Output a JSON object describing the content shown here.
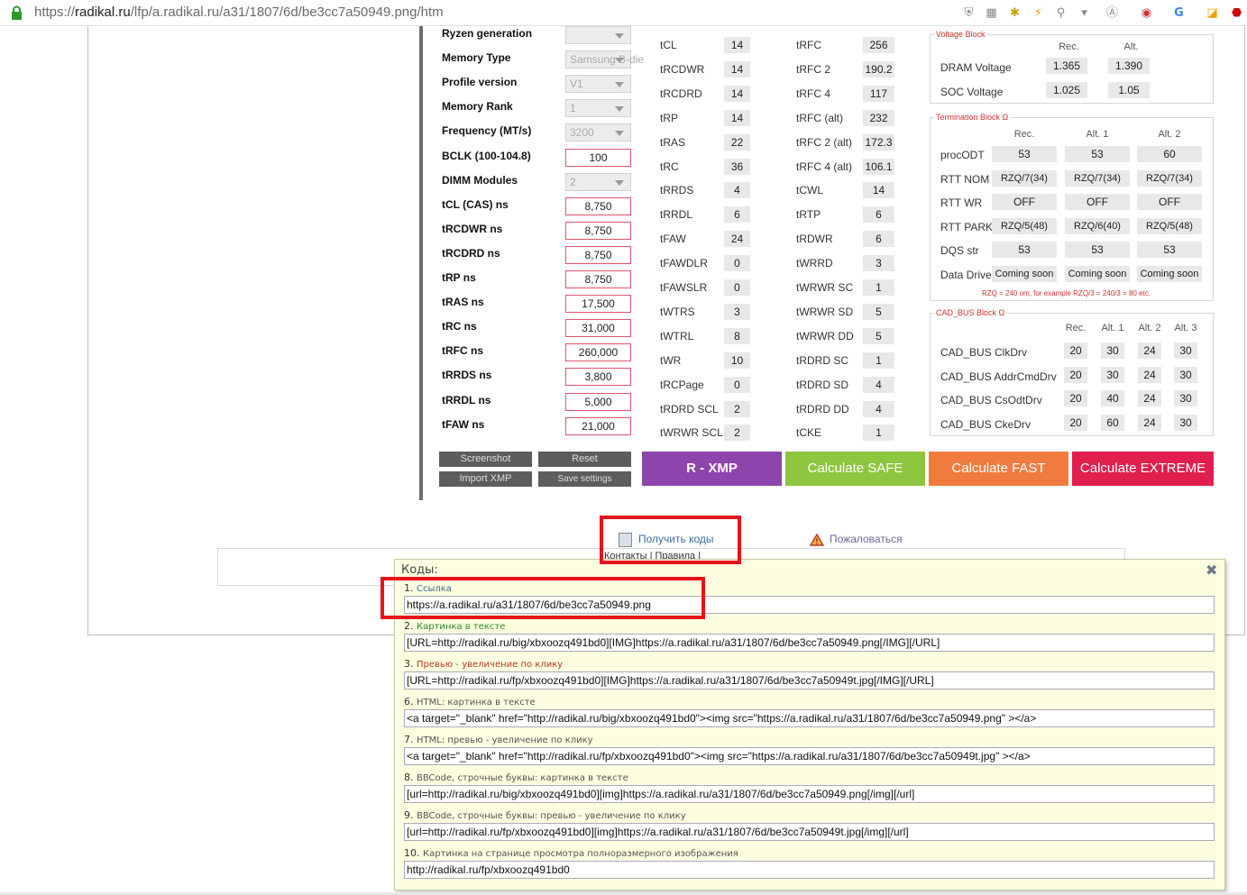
{
  "browser": {
    "url_prefix": "https://",
    "url_host": "radikal.ru",
    "url_path": "/lfp/a.radikal.ru/a31/1807/6d/be3cc7a50949.png/htm"
  },
  "left_panel": {
    "rows": [
      {
        "label": "Ryzen generation",
        "value": "",
        "kind": "select"
      },
      {
        "label": "Memory Type",
        "value": "Samsung B-die",
        "kind": "select"
      },
      {
        "label": "Profile version",
        "value": "V1",
        "kind": "select"
      },
      {
        "label": "Memory Rank",
        "value": "1",
        "kind": "select"
      },
      {
        "label": "Frequency (MT/s)",
        "value": "3200",
        "kind": "select"
      },
      {
        "label": "BCLK (100-104.8)",
        "value": "100",
        "kind": "input"
      },
      {
        "label": "DIMM Modules",
        "value": "2",
        "kind": "select"
      },
      {
        "label": "tCL (CAS) ns",
        "value": "8,750",
        "kind": "input"
      },
      {
        "label": "tRCDWR ns",
        "value": "8,750",
        "kind": "input"
      },
      {
        "label": "tRCDRD ns",
        "value": "8,750",
        "kind": "input"
      },
      {
        "label": "tRP ns",
        "value": "8,750",
        "kind": "input"
      },
      {
        "label": "tRAS ns",
        "value": "17,500",
        "kind": "input"
      },
      {
        "label": "tRC ns",
        "value": "31,000",
        "kind": "input"
      },
      {
        "label": "tRFC ns",
        "value": "260,000",
        "kind": "input"
      },
      {
        "label": "tRRDS ns",
        "value": "3,800",
        "kind": "input"
      },
      {
        "label": "tRRDL ns",
        "value": "5,000",
        "kind": "input"
      },
      {
        "label": "tFAW ns",
        "value": "21,000",
        "kind": "input"
      }
    ]
  },
  "timings_col1": [
    {
      "label": "tCL",
      "value": "14"
    },
    {
      "label": "tRCDWR",
      "value": "14"
    },
    {
      "label": "tRCDRD",
      "value": "14"
    },
    {
      "label": "tRP",
      "value": "14"
    },
    {
      "label": "tRAS",
      "value": "22"
    },
    {
      "label": "tRC",
      "value": "36"
    },
    {
      "label": "tRRDS",
      "value": "4"
    },
    {
      "label": "tRRDL",
      "value": "6"
    },
    {
      "label": "tFAW",
      "value": "24"
    },
    {
      "label": "tFAWDLR",
      "value": "0"
    },
    {
      "label": "tFAWSLR",
      "value": "0"
    },
    {
      "label": "tWTRS",
      "value": "3"
    },
    {
      "label": "tWTRL",
      "value": "8"
    },
    {
      "label": "tWR",
      "value": "10"
    },
    {
      "label": "tRCPage",
      "value": "0"
    },
    {
      "label": "tRDRD SCL",
      "value": "2"
    },
    {
      "label": "tWRWR SCL",
      "value": "2"
    }
  ],
  "timings_col2": [
    {
      "label": "tRFC",
      "value": "256"
    },
    {
      "label": "tRFC 2",
      "value": "190.2"
    },
    {
      "label": "tRFC 4",
      "value": "117"
    },
    {
      "label": "tRFC (alt)",
      "value": "232"
    },
    {
      "label": "tRFC 2 (alt)",
      "value": "172.3"
    },
    {
      "label": "tRFC 4 (alt)",
      "value": "106.1"
    },
    {
      "label": "tCWL",
      "value": "14"
    },
    {
      "label": "tRTP",
      "value": "6"
    },
    {
      "label": "tRDWR",
      "value": "6"
    },
    {
      "label": "tWRRD",
      "value": "3"
    },
    {
      "label": "tWRWR SC",
      "value": "1"
    },
    {
      "label": "tWRWR SD",
      "value": "5"
    },
    {
      "label": "tWRWR DD",
      "value": "5"
    },
    {
      "label": "tRDRD SC",
      "value": "1"
    },
    {
      "label": "tRDRD SD",
      "value": "4"
    },
    {
      "label": "tRDRD DD",
      "value": "4"
    },
    {
      "label": "tCKE",
      "value": "1"
    }
  ],
  "voltage_block": {
    "title": "Voltage Block",
    "headers": [
      "Rec.",
      "Alt."
    ],
    "rows": [
      {
        "label": "DRAM Voltage",
        "values": [
          "1.365",
          "1.390"
        ]
      },
      {
        "label": "SOC Voltage",
        "values": [
          "1.025",
          "1.05"
        ]
      }
    ]
  },
  "termination_block": {
    "title": "Termination Block Ω",
    "headers": [
      "Rec.",
      "Alt. 1",
      "Alt. 2"
    ],
    "rows": [
      {
        "label": "procODT",
        "values": [
          "53",
          "53",
          "60"
        ]
      },
      {
        "label": "RTT NOM",
        "values": [
          "RZQ/7(34)",
          "RZQ/7(34)",
          "RZQ/7(34)"
        ]
      },
      {
        "label": "RTT WR",
        "values": [
          "OFF",
          "OFF",
          "OFF"
        ]
      },
      {
        "label": "RTT PARK",
        "values": [
          "RZQ/5(48)",
          "RZQ/6(40)",
          "RZQ/5(48)"
        ]
      },
      {
        "label": "DQS str",
        "values": [
          "53",
          "53",
          "53"
        ]
      },
      {
        "label": "Data Drive",
        "values": [
          "Coming soon",
          "Coming soon",
          "Coming soon"
        ]
      }
    ],
    "note": "RZQ = 240 om, for example RZQ/3 = 240/3 = 80 etc."
  },
  "cad_bus_block": {
    "title": "CAD_BUS Block Ω",
    "headers": [
      "Rec.",
      "Alt. 1",
      "Alt. 2",
      "Alt. 3"
    ],
    "rows": [
      {
        "label": "CAD_BUS ClkDrv",
        "values": [
          "20",
          "30",
          "24",
          "30"
        ]
      },
      {
        "label": "CAD_BUS AddrCmdDrv",
        "values": [
          "20",
          "30",
          "24",
          "30"
        ]
      },
      {
        "label": "CAD_BUS CsOdtDrv",
        "values": [
          "20",
          "40",
          "24",
          "30"
        ]
      },
      {
        "label": "CAD_BUS CkeDrv",
        "values": [
          "20",
          "60",
          "24",
          "30"
        ]
      }
    ]
  },
  "buttons": {
    "screenshot": "Screenshot",
    "reset": "Reset",
    "import_xmp": "Import XMP",
    "save_settings": "Save settings",
    "r_xmp": "R - XMP",
    "calc_safe": "Calculate SAFE",
    "calc_fast": "Calculate FAST",
    "calc_extreme": "Calculate EXTREME"
  },
  "colors": {
    "r_xmp": "#8e44ad",
    "calc_safe": "#8dc63f",
    "calc_fast": "#f07b3f",
    "calc_extreme": "#e01f4e",
    "highlight_box": "#e8121a"
  },
  "actions": {
    "get_codes": "Получить коды",
    "complain": "Пожаловаться",
    "hidden_links": "Контакты | Правила |"
  },
  "popup": {
    "title": "Коды:",
    "close_icon": "close-icon",
    "items": [
      {
        "num": "1.",
        "label": "Ссылка",
        "label_color": "#3d6e9b",
        "value": "https://a.radikal.ru/a31/1807/6d/be3cc7a50949.png"
      },
      {
        "num": "2.",
        "label": "Картинка в тексте",
        "label_color": "#2e8b2e",
        "value": "[URL=http://radikal.ru/big/xbxoozq491bd0][IMG]https://a.radikal.ru/a31/1807/6d/be3cc7a50949.png[/IMG][/URL]"
      },
      {
        "num": "3.",
        "label": "Превью - увеличение по клику",
        "label_color": "#b23a1e",
        "value": "[URL=http://radikal.ru/fp/xbxoozq491bd0][IMG]https://a.radikal.ru/a31/1807/6d/be3cc7a50949t.jpg[/IMG][/URL]"
      },
      {
        "num": "6.",
        "label": "HTML: картинка в тексте",
        "label_color": "#555555",
        "value": "<a target=\"_blank\" href=\"http://radikal.ru/big/xbxoozq491bd0\"><img src=\"https://a.radikal.ru/a31/1807/6d/be3cc7a50949.png\" ></a>"
      },
      {
        "num": "7.",
        "label": "HTML: превью - увеличение по клику",
        "label_color": "#555555",
        "value": "<a target=\"_blank\" href=\"http://radikal.ru/fp/xbxoozq491bd0\"><img src=\"https://a.radikal.ru/a31/1807/6d/be3cc7a50949t.jpg\" ></a>"
      },
      {
        "num": "8.",
        "label": "BBCode, строчные буквы: картинка в тексте",
        "label_color": "#555555",
        "value": "[url=http://radikal.ru/big/xbxoozq491bd0][img]https://a.radikal.ru/a31/1807/6d/be3cc7a50949.png[/img][/url]"
      },
      {
        "num": "9.",
        "label": "BBCode, строчные буквы: превью - увеличение по клику",
        "label_color": "#555555",
        "value": "[url=http://radikal.ru/fp/xbxoozq491bd0][img]https://a.radikal.ru/a31/1807/6d/be3cc7a50949t.jpg[/img][/url]"
      },
      {
        "num": "10.",
        "label": "Картинка на странице просмотра полноразмерного изображения",
        "label_color": "#555555",
        "value": "http://radikal.ru/fp/xbxoozq491bd0"
      }
    ]
  }
}
